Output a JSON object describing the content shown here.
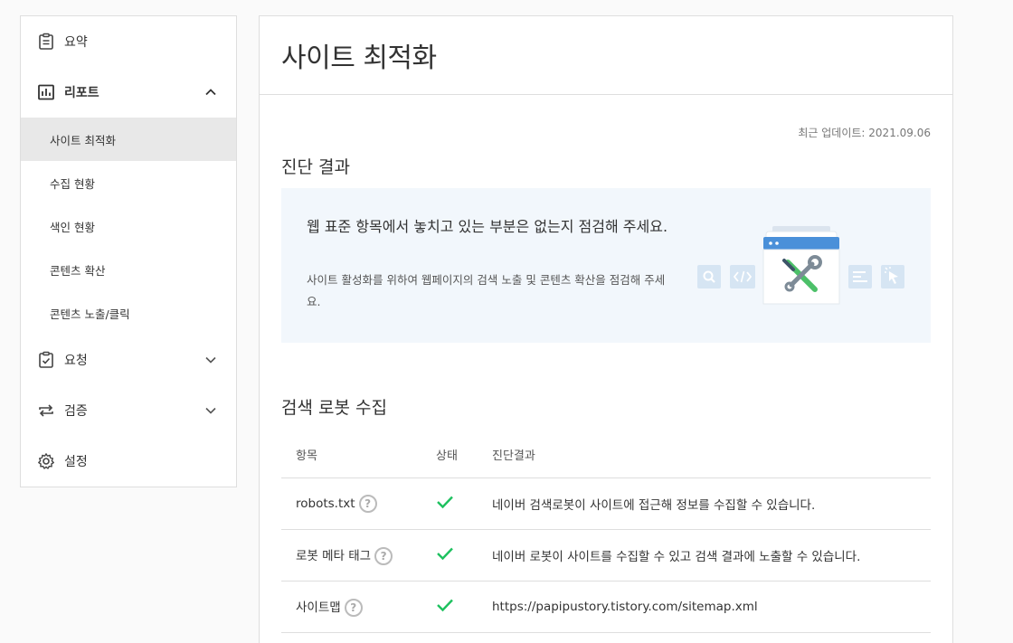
{
  "sidebar": {
    "summary": "요약",
    "report": "리포트",
    "report_items": [
      "사이트 최적화",
      "수집 현황",
      "색인 현황",
      "콘텐츠 확산",
      "콘텐츠 노출/클릭"
    ],
    "request": "요청",
    "verify": "검증",
    "settings": "설정"
  },
  "main": {
    "title": "사이트 최적화",
    "updated": "최근 업데이트: 2021.09.06",
    "diagnosis_title": "진단 결과",
    "banner": {
      "title": "웹 표준 항목에서 놓치고 있는 부분은 없는지 점검해 주세요.",
      "desc": "사이트 활성화를 위하여 웹페이지의 검색 노출 및 콘텐츠 확산을 점검해 주세요."
    },
    "robot_title": "검색 로봇 수집",
    "table": {
      "headers": [
        "항목",
        "상태",
        "진단결과"
      ],
      "rows": [
        {
          "item": "robots.txt",
          "result": "네이버 검색로봇이 사이트에 접근해 정보를 수집할 수 있습니다."
        },
        {
          "item": "로봇 메타 태그",
          "result": "네이버 로봇이 사이트를 수집할 수 있고 검색 결과에 노출할 수 있습니다."
        },
        {
          "item": "사이트맵",
          "result": "https://papipustory.tistory.com/sitemap.xml"
        }
      ],
      "help_glyph": "?"
    }
  },
  "colors": {
    "check": "#1ec15f",
    "banner_bg": "#f2f7fc",
    "active_bg": "#e8e8e8"
  }
}
